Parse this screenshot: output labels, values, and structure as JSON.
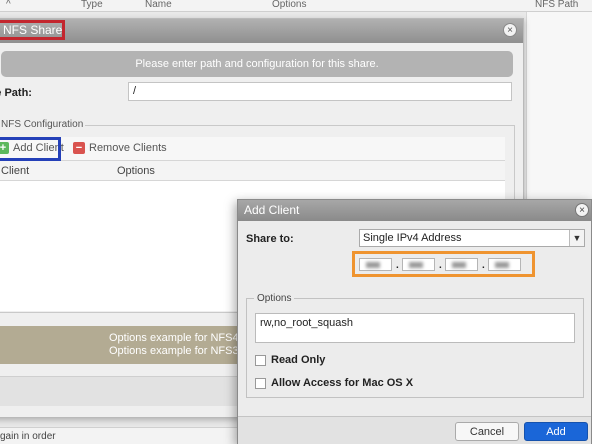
{
  "background": {
    "table_headers": {
      "col1": "^",
      "type": "Type",
      "name": "Name",
      "options": "Options",
      "nfs_path": "NFS Path"
    },
    "status_text": "gain in order"
  },
  "nfs_dialog": {
    "title": "NFS Share",
    "close": "×",
    "info": "Please enter path and configuration for this share.",
    "share_path_label": "re Path:",
    "share_path_value": "/",
    "config_legend": "NFS Configuration",
    "toolbar": {
      "add_client": "Add Client",
      "remove_client": "Remove Clients"
    },
    "columns": {
      "client": "Client",
      "options": "Options"
    },
    "examples": [
      "Options example for NFS4:",
      "Options example for NFS3:"
    ]
  },
  "add_client_dialog": {
    "title": "Add Client",
    "close": "×",
    "share_to_label": "Share to:",
    "share_to_value": "Single IPv4 Address",
    "options_legend": "Options",
    "options_value": "rw,no_root_squash",
    "read_only_label": "Read Only",
    "mac_access_label": "Allow Access for Mac OS X",
    "cancel_label": "Cancel",
    "add_label": "Add"
  },
  "colors": {
    "highlight_red": "#c3262e",
    "highlight_blue": "#2440b8",
    "highlight_orange": "#ef9430",
    "primary_button": "#1a66d8"
  }
}
